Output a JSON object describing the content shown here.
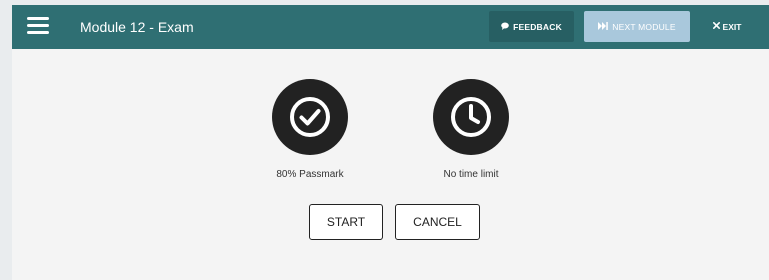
{
  "header": {
    "title": "Module 12 - Exam",
    "menu_icon": "hamburger-menu-icon",
    "feedback": {
      "icon": "speech-bubble-icon",
      "label": "FEEDBACK"
    },
    "next_module": {
      "icon": "skip-forward-icon",
      "label": "NEXT MODULE"
    },
    "exit": {
      "icon": "close-icon",
      "label": "EXIT"
    }
  },
  "exam_info": [
    {
      "icon": "check-circle-icon",
      "caption": "80% Passmark"
    },
    {
      "icon": "clock-icon",
      "caption": "No time limit"
    }
  ],
  "actions": {
    "start_label": "START",
    "cancel_label": "CANCEL"
  },
  "colors": {
    "header_bg": "#2f6f73",
    "feedback_bg": "#275f63",
    "next_module_bg": "#a9c8dc",
    "content_bg": "#f4f4f4",
    "icon_circle": "#222222"
  }
}
